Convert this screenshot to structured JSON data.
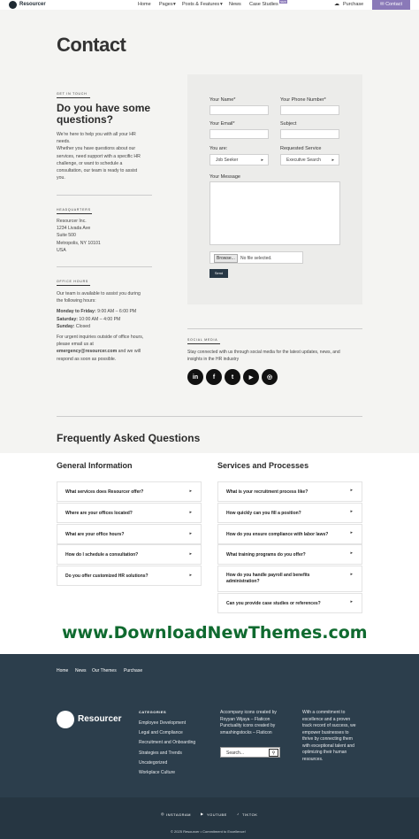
{
  "header": {
    "logo_text": "Resourcer",
    "nav": [
      "Home",
      "Pages",
      "Posts & Features",
      "News",
      "Case Studies"
    ],
    "new_badge": "NEW",
    "purchase": "Purchase",
    "contact": "Contact"
  },
  "page": {
    "title": "Contact"
  },
  "intro": {
    "eyebrow": "GET IN TOUCH",
    "heading_line1": "Do you have some",
    "heading_line2": "questions?",
    "lines": [
      "We're here to help you with all your HR",
      "needs.",
      "Whether you have questions about our",
      "services, need support with a specific HR",
      "challenge, or want to schedule a",
      "consultation, our team is ready to assist",
      "you."
    ]
  },
  "hq": {
    "eyebrow": "HEADQUARTERS",
    "name": "Resourcer Inc.",
    "lines": [
      "1234 Livada Ave",
      "Suite 500",
      "Metropolis, NY 10101",
      "USA"
    ]
  },
  "hours": {
    "eyebrow": "OFFICE HOURS",
    "intro1": "Our team is available to assist you during",
    "intro2": "the following hours:",
    "mf_label": "Monday to Friday:",
    "mf_value": " 9:00 AM – 6:00 PM",
    "sat_label": "Saturday:",
    "sat_value": " 10:00 AM – 4:00 PM",
    "sun_label": "Sunday:",
    "sun_value": " Closed",
    "urgent1": "For urgent inquiries outside of office hours,",
    "urgent2": "please email us at",
    "email": "emergency@resourcer.com",
    "urgent3": " and we will",
    "urgent4": "respond as soon as possible."
  },
  "form": {
    "name_label": "Your Name*",
    "phone_label": "Your Phone Number*",
    "email_label": "Your Email*",
    "subject_label": "Subject",
    "you_are_label": "You are:",
    "you_are_value": "Job Seeker",
    "service_label": "Requested Service",
    "service_value": "Executive Search",
    "message_label": "Your Message",
    "browse": "Browse...",
    "no_file": "No file selected.",
    "send": "Send"
  },
  "social": {
    "eyebrow": "SOCIAL MEDIA",
    "text1": "Stay connected with us through social media for the latest updates, news, and",
    "text2": "insights in the HR industry",
    "icons": [
      "in",
      "f",
      "t",
      "▶",
      "◎"
    ]
  },
  "faq": {
    "title": "Frequently Asked Questions",
    "general_title": "General Information",
    "general": [
      "What services does Resourcer offer?",
      "Where are your offices located?",
      "What are your office hours?",
      "How do I schedule a consultation?",
      "Do you offer customized HR solutions?"
    ],
    "services_title": "Services and Processes",
    "services": [
      "What is your recruitment process like?",
      "How quickly can you fill a position?",
      "How do you ensure compliance with labor laws?",
      "What training programs do you offer?",
      "How do you handle payroll and benefits administration?",
      "Can you provide case studies or references?"
    ]
  },
  "watermark": "www.DownloadNewThemes.com",
  "footer": {
    "links": [
      "Home",
      "News",
      "Our Themes",
      "Purchase"
    ],
    "logo_text": "Resourcer",
    "categories_title": "CATEGORIES",
    "categories": [
      "Employee Development",
      "Legal and Compliance",
      "Recruitment and Onboarding",
      "Strategies and Trends",
      "Uncategorized",
      "Workplace Culture"
    ],
    "credits": [
      "Accompany icons created by",
      "Royyan Wijaya – Flaticon",
      "Punctuality icons created by",
      "smashingstocks – Flaticon"
    ],
    "search_placeholder": "Search...",
    "about": [
      "With a commitment to",
      "excellence and a proven",
      "track record of success, we",
      "empower businesses to",
      "thrive by connecting them",
      "with exceptional talent and",
      "optimizing their human",
      "resources."
    ],
    "social": [
      "INSTAGRAM",
      "YOUTUBE",
      "TIKTOK"
    ],
    "copyright": "© 2025 Resourcer • Commitment to Excellence!"
  }
}
